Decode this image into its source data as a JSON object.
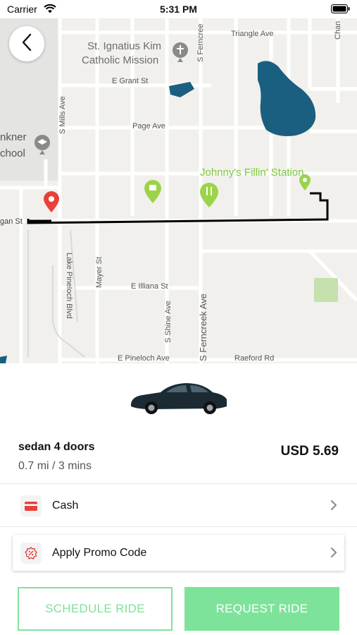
{
  "status_bar": {
    "carrier": "Carrier",
    "time": "5:31 PM"
  },
  "map": {
    "labels": {
      "mission": "St. Ignatius Kim",
      "mission_line2": "Catholic Mission",
      "triangle_ave": "Triangle Ave",
      "s_ferncreek_top": "S Ferncree",
      "chan": "Chan",
      "e_grant_st": "E Grant St",
      "s_mills_ave": "S Mills Ave",
      "nkner": "nkner",
      "chool": "chool",
      "page_ave": "Page Ave",
      "johnnys": "Johnny's Fillin' Station",
      "gan_st": "gan St",
      "lake_pineloch_blvd": "Lake Pineloch Blvd",
      "mayer_st": "Mayer St",
      "e_illiana_st": "E Illiana St",
      "s_shine_ave": "S Shine Ave",
      "s_ferncreek_ave": "S Ferncreek Ave",
      "e_pineloch_ave": "E Pineloch Ave",
      "raeford_rd": "Raeford Rd"
    },
    "colors": {
      "water": "#1a5f80",
      "route": "#000000",
      "pin_origin": "#e8403b",
      "pin_poi": "#9bd34a",
      "park": "#c6e0ae"
    }
  },
  "ride": {
    "vehicle_name": "sedan 4 doors",
    "eta": "0.7 mi / 3 mins",
    "price": "USD 5.69"
  },
  "payment": {
    "label": "Cash",
    "icon": "credit-card-icon"
  },
  "promo": {
    "label": "Apply Promo Code",
    "icon": "discount-badge-icon"
  },
  "actions": {
    "schedule_label": "SCHEDULE RIDE",
    "request_label": "REQUEST RIDE",
    "accent_color": "#7ee39a"
  }
}
